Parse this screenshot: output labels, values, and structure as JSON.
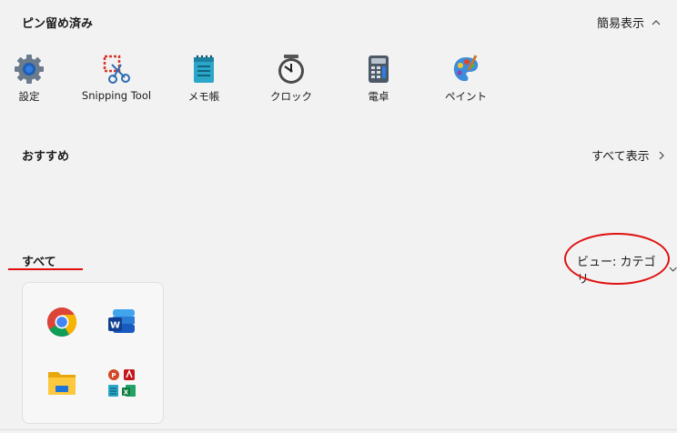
{
  "pinned": {
    "title": "ピン留め済み",
    "toggle_label": "簡易表示",
    "toggle_chevron": "^",
    "apps": [
      {
        "label": "設定",
        "icon": "gear-icon"
      },
      {
        "label": "Snipping Tool",
        "icon": "scissors-icon"
      },
      {
        "label": "メモ帳",
        "icon": "notepad-icon"
      },
      {
        "label": "クロック",
        "icon": "clock-icon"
      },
      {
        "label": "電卓",
        "icon": "calculator-icon"
      },
      {
        "label": "ペイント",
        "icon": "paint-icon"
      }
    ]
  },
  "recommended": {
    "title": "おすすめ",
    "show_all_label": "すべて表示",
    "show_all_chevron": ">"
  },
  "all": {
    "title": "すべて",
    "view_label": "ビュー: カテゴリ",
    "view_chevron": "v",
    "category_icons": [
      "chrome-icon",
      "word-icon",
      "file-explorer-icon",
      "office-apps-icon"
    ]
  },
  "annotations": {
    "underline_color": "#e01010",
    "ellipse_color": "#e01010"
  }
}
